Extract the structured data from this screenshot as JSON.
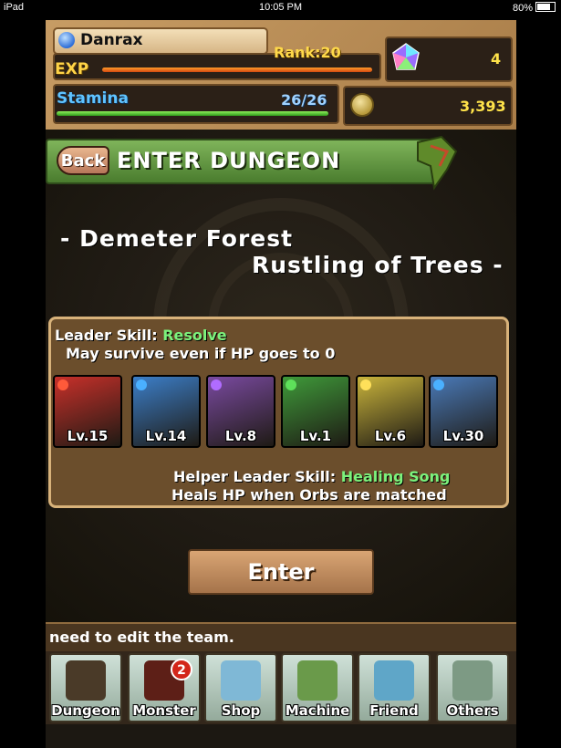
{
  "statusbar": {
    "device": "iPad",
    "time": "10:05 PM",
    "battery": "80%"
  },
  "player": {
    "name": "Danrax",
    "rank": "Rank:20",
    "exp_label": "EXP",
    "stamina_label": "Stamina",
    "stamina_value": "26/26",
    "magic_stones": "4",
    "coins": "3,393"
  },
  "header": {
    "back_label": "Back",
    "title": "ENTER DUNGEON"
  },
  "dungeon": {
    "name": "- Demeter Forest",
    "stage": "Rustling of Trees -"
  },
  "team": {
    "leader_skill_label": "Leader Skill:",
    "leader_skill_name": "Resolve",
    "leader_skill_desc": "May survive even if HP goes to 0",
    "members": [
      {
        "level": "Lv.15",
        "attribute": "fire",
        "color": "#c8302a"
      },
      {
        "level": "Lv.14",
        "attribute": "water",
        "color": "#3c7fc9"
      },
      {
        "level": "Lv.8",
        "attribute": "dark",
        "color": "#7a4aa0"
      },
      {
        "level": "Lv.1",
        "attribute": "wood",
        "color": "#3f9a3a"
      },
      {
        "level": "Lv.6",
        "attribute": "light",
        "color": "#c9b43c"
      },
      {
        "level": "Lv.30",
        "attribute": "water",
        "color": "#4a7ab8"
      }
    ],
    "helper_skill_label": "Helper Leader Skill:",
    "helper_skill_name": "Healing Song",
    "helper_skill_desc": "Heals HP when Orbs are matched"
  },
  "enter_label": "Enter",
  "tip": "need to edit the team.",
  "nav": [
    {
      "label": "Dungeon",
      "icon": "dungeon-gate-icon"
    },
    {
      "label": "Monster",
      "icon": "monster-icon",
      "badge": "2"
    },
    {
      "label": "Shop",
      "icon": "gem-icon"
    },
    {
      "label": "Machine",
      "icon": "egg-icon"
    },
    {
      "label": "Friend",
      "icon": "friends-icon"
    },
    {
      "label": "Others",
      "icon": "question-icon"
    }
  ]
}
